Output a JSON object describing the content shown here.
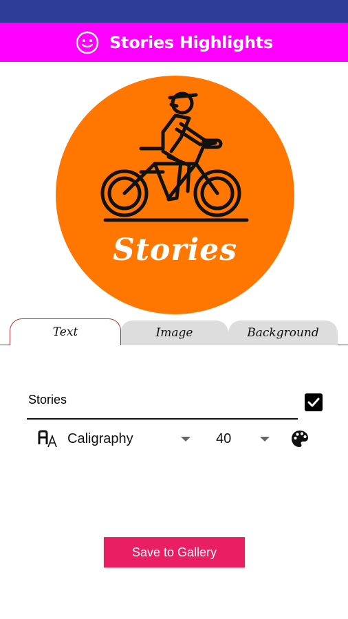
{
  "app": {
    "title": "Stories Highlights",
    "logo_icon": "smiley-face-icon",
    "colors": {
      "status_bar": "#2e3d97",
      "app_bar": "#ff00ff",
      "preview_background": "#ff7700",
      "save_button": "#e91e63",
      "tab_accent": "#b03030"
    }
  },
  "preview": {
    "icon": "bicycle-rider-icon",
    "caption": "Stories"
  },
  "tabs": [
    {
      "label": "Text",
      "active": true
    },
    {
      "label": "Image",
      "active": false
    },
    {
      "label": "Background",
      "active": false
    }
  ],
  "text_panel": {
    "text_value": "Stories",
    "show_text_checked": true,
    "font_icon": "font-style-icon",
    "font_family_selected": "Caligraphy",
    "font_size_selected": "40",
    "color_icon": "palette-icon"
  },
  "actions": {
    "save_label": "Save to Gallery"
  }
}
